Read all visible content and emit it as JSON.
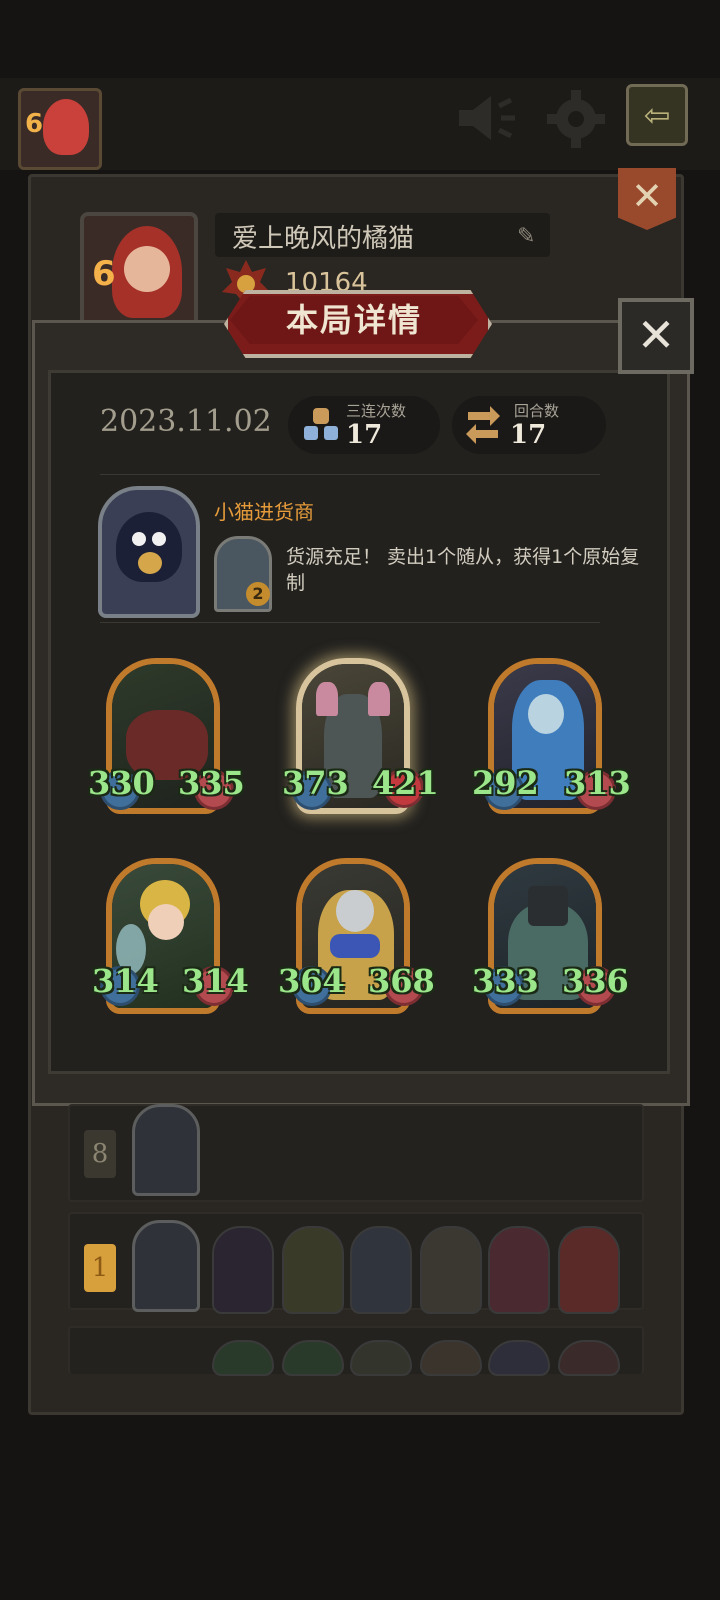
{
  "top_bar": {
    "player_level": "6",
    "icons": [
      "speaker-icon",
      "gear-icon",
      "back-arrow-icon"
    ]
  },
  "profile": {
    "level": "6",
    "name": "爱上晚风的橘猫",
    "score": "10164"
  },
  "modal": {
    "title": "本局详情",
    "date": "2023.11.02",
    "triple_label": "三连次数",
    "triple_value": "17",
    "round_label": "回合数",
    "round_value": "17",
    "hero_name": "小猫进货商",
    "power_cost": "2",
    "power_desc": "货源充足！ 卖出1个随从，获得1个原始复制",
    "minions": [
      {
        "attack": "330",
        "health": "335",
        "golden": false
      },
      {
        "attack": "373",
        "health": "421",
        "golden": true
      },
      {
        "attack": "292",
        "health": "313",
        "golden": false
      },
      {
        "attack": "314",
        "health": "314",
        "golden": false
      },
      {
        "attack": "364",
        "health": "368",
        "golden": false
      },
      {
        "attack": "333",
        "health": "336",
        "golden": false
      }
    ]
  },
  "list": {
    "rows": [
      {
        "rank": "8"
      },
      {
        "rank": "1"
      }
    ]
  },
  "colors": {
    "accent_orange": "#e59b3a",
    "stat_green": "#9be58a",
    "title_red": "#7c1c1a"
  }
}
